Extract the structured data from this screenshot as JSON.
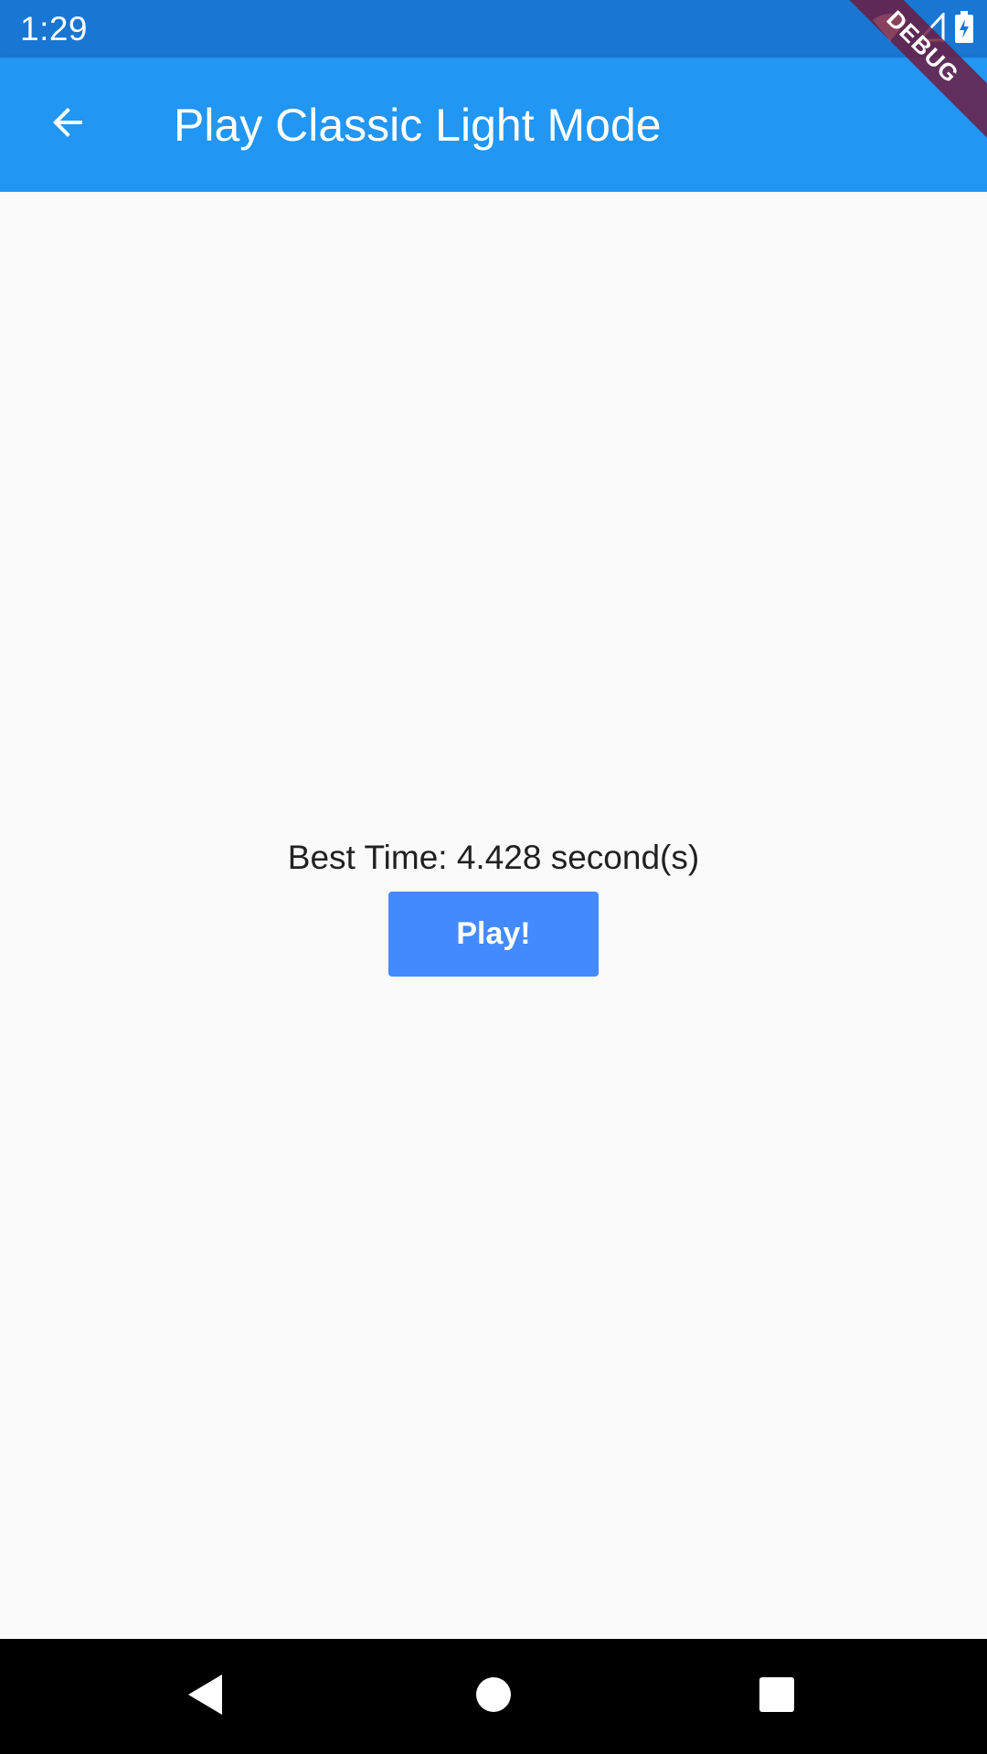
{
  "status_bar": {
    "time": "1:29",
    "icons": [
      "wifi-icon",
      "cellular-signal-icon",
      "battery-charging-icon"
    ]
  },
  "app_bar": {
    "back_icon": "arrow-back-icon",
    "title": "Play Classic Light Mode"
  },
  "debug_banner": {
    "label": "DEBUG"
  },
  "main": {
    "best_time": "Best Time: 4.428 second(s)",
    "play_label": "Play!"
  },
  "nav_bar": {
    "icons": [
      "nav-back-icon",
      "nav-home-icon",
      "nav-recents-icon"
    ]
  },
  "colors": {
    "status_bar": "#1976d2",
    "app_bar": "#2196f3",
    "background": "#fafafa",
    "play_button": "#448aff",
    "nav_bar": "#000000",
    "debug_banner": "#6e183c"
  }
}
